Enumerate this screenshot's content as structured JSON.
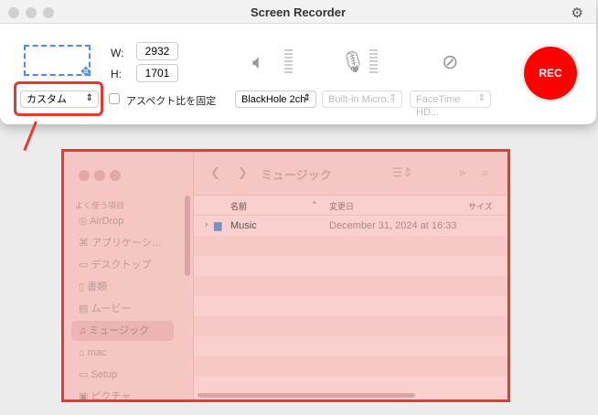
{
  "window": {
    "title": "Screen Recorder"
  },
  "size": {
    "w_label": "W:",
    "w_value": "2932",
    "h_label": "H:",
    "h_value": "1701"
  },
  "preset": "カスタム",
  "aspect_label": "アスペクト比を固定",
  "audio": {
    "system": "BlackHole 2ch",
    "mic": "Built-in Micro...",
    "camera": "FaceTime HD..."
  },
  "rec_label": "REC",
  "finder": {
    "title": "ミュージック",
    "sidebar_header": "よく使う項目",
    "sidebar": [
      {
        "icon": "airdrop-icon",
        "g": "◎",
        "label": "AirDrop"
      },
      {
        "icon": "applications-icon",
        "g": "⌘",
        "label": "アプリケーシ…"
      },
      {
        "icon": "desktop-icon",
        "g": "▭",
        "label": "デスクトップ"
      },
      {
        "icon": "document-icon",
        "g": "▯",
        "label": "書類"
      },
      {
        "icon": "movie-icon",
        "g": "▤",
        "label": "ムービー"
      },
      {
        "icon": "music-icon",
        "g": "♫",
        "label": "ミュージック"
      },
      {
        "icon": "home-icon",
        "g": "⌂",
        "label": "mac"
      },
      {
        "icon": "folder-icon",
        "g": "▭",
        "label": "Setup"
      },
      {
        "icon": "pictures-icon",
        "g": "▣",
        "label": "ピクチャ"
      }
    ],
    "columns": {
      "name": "名前",
      "date": "変更日",
      "size": "サイズ"
    },
    "rows": [
      {
        "name": "Music",
        "date": "December 31, 2024 at 16:33"
      }
    ]
  }
}
